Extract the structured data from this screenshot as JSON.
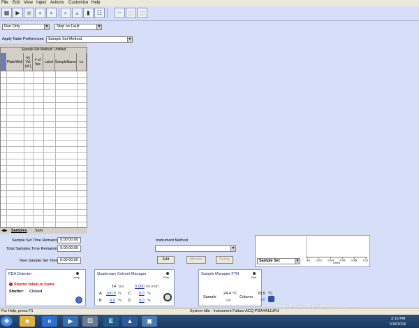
{
  "menu": [
    "File",
    "Edit",
    "View",
    "Inject",
    "Actions",
    "Customize",
    "Help"
  ],
  "toolbar_icons": [
    "new-icon",
    "open-icon",
    "save-icon",
    "stop-icon",
    "pause-icon",
    "run-icon",
    "prime-icon",
    "column-icon",
    "grid-icon",
    "cut-icon",
    "copy-icon",
    "paste-icon"
  ],
  "run_mode": "Run Only",
  "fault_mode": "Stop on Fault",
  "apply_prefs_label": "Apply Table Preferences",
  "apply_prefs_value": "Sample Set Method",
  "table": {
    "title": "Sample Set Method: Untitled",
    "columns": [
      "Plate/Well",
      "Inj Vol (uL)",
      "# of Injs",
      "Label",
      "SampleName",
      "Le"
    ]
  },
  "tabs": [
    "Samples",
    "Sam"
  ],
  "times": {
    "set_label": "Sample Set Time Remaining:",
    "set_value": "0:00:00:00",
    "total_label": "Total Samples Time Remaining:",
    "total_value": "0:00:00:00",
    "new_label": "New Sample Set Time:",
    "new_value": "0:00:00:00"
  },
  "instrument": {
    "label": "Instrument Method",
    "edit": "Edit",
    "monitor": "Monitor",
    "setup": "Setup"
  },
  "sample_set_select": "Sample Set",
  "chart_data": {
    "type": "line",
    "x_ticks": [
      "0.000",
      "0.002",
      "0.004",
      "0.006",
      "0.008",
      "0.010"
    ],
    "xlabel": "Liters",
    "series": []
  },
  "pda": {
    "title": "PDA Detector",
    "lamp_label": "Lamp",
    "error": "Shutter failed to home",
    "shutter_label": "Shutter:",
    "shutter_value": "Closed"
  },
  "qsm": {
    "title": "Quaternary Solvent Manager",
    "flow_label": "Flow",
    "pressure": "14",
    "pressure_unit": "psi",
    "flow": "0.000",
    "flow_unit": "mL/min",
    "a_label": "A",
    "a_value": "100.0",
    "a_unit": "%",
    "b_label": "B",
    "b_value": "0.0",
    "b_unit": "%",
    "c_label": "C",
    "c_value": "0.0",
    "c_unit": "%",
    "d_label": "D",
    "d_value": "0.0",
    "d_unit": "%"
  },
  "smftn": {
    "title": "Sample Manager FTN",
    "run_label": "Run",
    "sample_label": "Sample",
    "sample_temp": "24.4",
    "column_label": "Column",
    "column_temp": "26.5",
    "unit": "°C",
    "off": "Off"
  },
  "status": {
    "help": "For Help, press F1",
    "main": "System Idle - Instrument Failure ACQ-PDA#A11UPd"
  },
  "watermark": "知乎 @菜鸟博士Caesar",
  "clock": {
    "time": "3:16 PM",
    "date": "7/18/2016"
  },
  "colors": {
    "panel_blue": "#d6dff7",
    "error_red": "#d01010",
    "link_blue": "#1f3fa8"
  }
}
